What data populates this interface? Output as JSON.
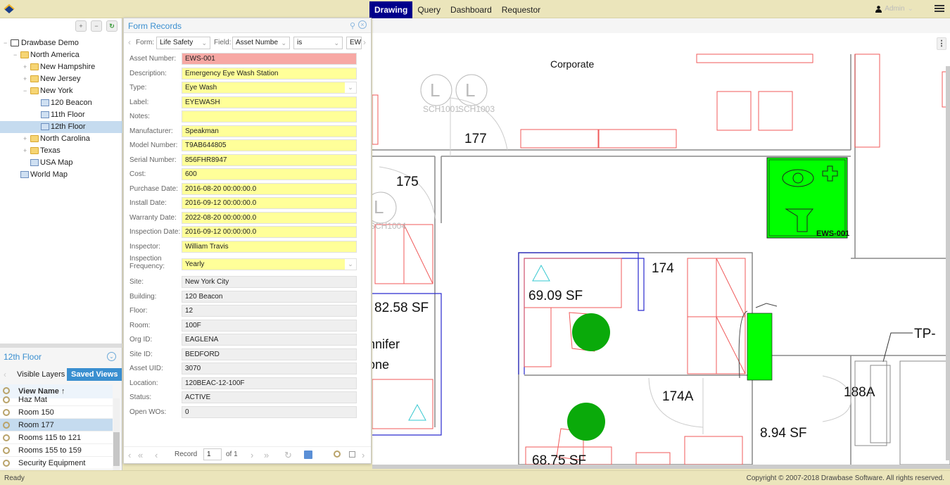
{
  "topbar": {
    "nav": [
      {
        "label": "Drawing",
        "active": true
      },
      {
        "label": "Query",
        "active": false
      },
      {
        "label": "Dashboard",
        "active": false
      },
      {
        "label": "Requestor",
        "active": false
      }
    ],
    "user": "Admin",
    "user_icon": "user-icon",
    "menu_icon": "hamburger-icon"
  },
  "tree": {
    "tools": [
      "expand-all-icon",
      "collapse-all-icon",
      "refresh-icon"
    ],
    "nodes": [
      {
        "label": "Drawbase Demo",
        "type": "root"
      },
      {
        "label": "North America",
        "type": "folder"
      },
      {
        "label": "New Hampshire",
        "type": "folder"
      },
      {
        "label": "New Jersey",
        "type": "folder"
      },
      {
        "label": "New York",
        "type": "folder"
      },
      {
        "label": "120 Beacon",
        "type": "drawing"
      },
      {
        "label": "11th Floor",
        "type": "drawing"
      },
      {
        "label": "12th Floor",
        "type": "drawing",
        "selected": true
      },
      {
        "label": "North Carolina",
        "type": "folder"
      },
      {
        "label": "Texas",
        "type": "folder"
      },
      {
        "label": "USA Map",
        "type": "drawing"
      },
      {
        "label": "World Map",
        "type": "drawing"
      }
    ]
  },
  "layers_panel": {
    "title": "12th Floor",
    "tabs": [
      {
        "label": "Visible Layers",
        "active": false
      },
      {
        "label": "Saved Views",
        "active": true
      }
    ],
    "column_header": "View Name ↑",
    "rows": [
      {
        "label": "Haz Mat",
        "selected": false
      },
      {
        "label": "Room 150",
        "selected": false
      },
      {
        "label": "Room 177",
        "selected": true
      },
      {
        "label": "Rooms 115 to 121",
        "selected": false
      },
      {
        "label": "Rooms 155 to 159",
        "selected": false
      },
      {
        "label": "Security Equipment",
        "selected": false
      }
    ]
  },
  "form": {
    "title": "Form Records",
    "filter": {
      "form_label": "Form:",
      "form_value": "Life Safety",
      "field_label": "Field:",
      "field_value": "Asset Numbe",
      "operator_value": "is",
      "value": "EW"
    },
    "fields": [
      {
        "label": "Asset Number:",
        "value": "EWS-001",
        "style": "red"
      },
      {
        "label": "Description:",
        "value": "Emergency Eye Wash Station",
        "style": "yellow"
      },
      {
        "label": "Type:",
        "value": "Eye Wash",
        "style": "yellow",
        "dropdown": true
      },
      {
        "label": "Label:",
        "value": "EYEWASH",
        "style": "yellow"
      },
      {
        "label": "Notes:",
        "value": "",
        "style": "yellow"
      },
      {
        "label": "Manufacturer:",
        "value": "Speakman",
        "style": "yellow"
      },
      {
        "label": "Model Number:",
        "value": "T9AB644805",
        "style": "yellow"
      },
      {
        "label": "Serial Number:",
        "value": "856FHR8947",
        "style": "yellow"
      },
      {
        "label": "Cost:",
        "value": "600",
        "style": "yellow"
      },
      {
        "label": "Purchase Date:",
        "value": "2016-08-20 00:00:00.0",
        "style": "yellow"
      },
      {
        "label": "Install Date:",
        "value": "2016-09-12 00:00:00.0",
        "style": "yellow"
      },
      {
        "label": "Warranty Date:",
        "value": "2022-08-20 00:00:00.0",
        "style": "yellow"
      },
      {
        "label": "Inspection Date:",
        "value": "2016-09-12 00:00:00.0",
        "style": "yellow"
      },
      {
        "label": "Inspector:",
        "value": "William Travis",
        "style": "yellow"
      },
      {
        "label": "Inspection Frequency:",
        "value": "Yearly",
        "style": "yellow",
        "dropdown": true
      },
      {
        "label": "Site:",
        "value": "New York City",
        "style": "gray"
      },
      {
        "label": "Building:",
        "value": "120 Beacon",
        "style": "gray"
      },
      {
        "label": "Floor:",
        "value": "12",
        "style": "gray"
      },
      {
        "label": "Room:",
        "value": "100F",
        "style": "gray"
      },
      {
        "label": "Org ID:",
        "value": "EAGLENA",
        "style": "gray"
      },
      {
        "label": "Site ID:",
        "value": "BEDFORD",
        "style": "gray"
      },
      {
        "label": "Asset UID:",
        "value": "3070",
        "style": "gray"
      },
      {
        "label": "Location:",
        "value": "120BEAC-12-100F",
        "style": "gray"
      },
      {
        "label": "Status:",
        "value": "ACTIVE",
        "style": "gray"
      },
      {
        "label": "Open WOs:",
        "value": "0",
        "style": "gray"
      }
    ],
    "pager": {
      "record_label": "Record",
      "current": "1",
      "of_label": "of 1"
    }
  },
  "drawing": {
    "labels": {
      "corporate": "Corporate",
      "room_177": "177",
      "room_175": "175",
      "room_174": "174",
      "room_174a": "174A",
      "room_188a": "188A",
      "area_6909": "69.09 SF",
      "area_8258": "82.58 SF",
      "area_6875": "68.75 SF",
      "area_894": "8.94 SF",
      "occupant_1": "nnifer",
      "occupant_2": "one",
      "tp_label": "TP-",
      "sch1001": "SCH1001",
      "sch1003": "SCH1003",
      "sch1004": "SCH1004",
      "light_symbol": "L",
      "eyewash_tag": "EWS-001"
    },
    "colors": {
      "furniture": "#f05a5a",
      "wall": "#888888",
      "boundary": "#2a2acf",
      "asset_fill": "#00ff00",
      "occupant_fill": "#0aaa0a",
      "marker": "#36c8d0"
    }
  },
  "status": {
    "left": "Ready",
    "right": "Copyright © 2007-2018 Drawbase Software. All rights reserved."
  }
}
